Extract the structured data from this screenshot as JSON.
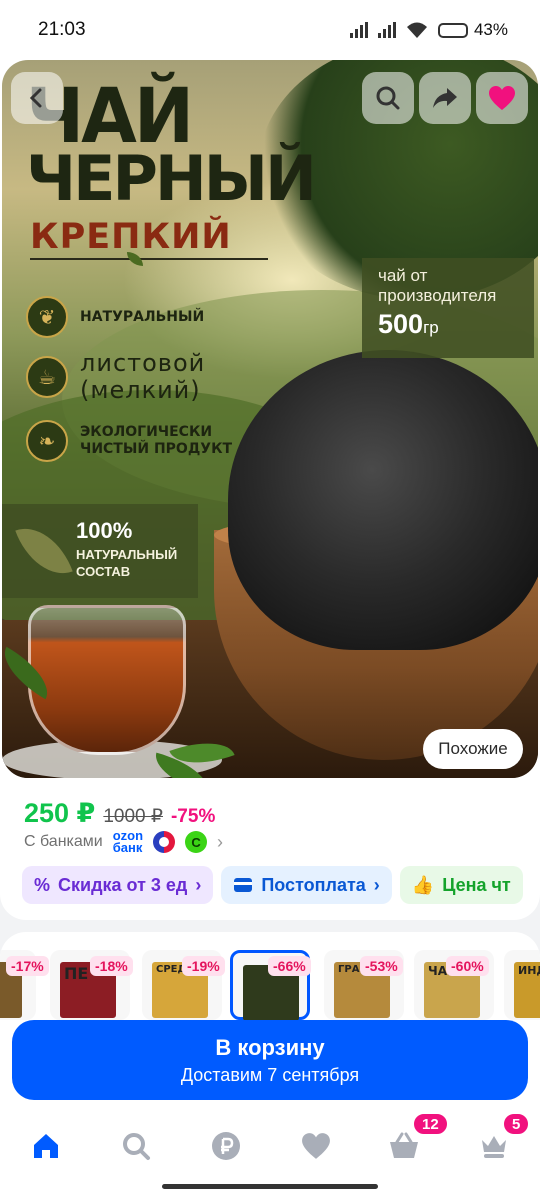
{
  "status_bar": {
    "time": "21:03",
    "battery": "43%"
  },
  "gallery": {
    "headline_line1": "ЧАЙ",
    "headline_line2": "ЧЕРНЫЙ",
    "headline_sub": "КРЕПКИЙ",
    "features": [
      {
        "icon": "leaf-icon",
        "text": "НАТУРАЛЬНЫЙ"
      },
      {
        "icon": "teacup-icon",
        "text_line1": "листовой",
        "text_line2": "(мелкий)"
      },
      {
        "icon": "eco-leaf-icon",
        "text_line1": "ЭКОЛОГИЧЕСКИ",
        "text_line2": "ЧИСТЫЙ ПРОДУКТ"
      }
    ],
    "producer_line1": "чай от",
    "producer_line2": "производителя",
    "weight_value": "500",
    "weight_unit": "гр",
    "natural_percent": "100%",
    "natural_line1": "НАТУРАЛЬНЫЙ",
    "natural_line2": "СОСТАВ",
    "similar_label": "Похожие"
  },
  "price": {
    "current": "250 ₽",
    "old": "1000 ₽",
    "discount": "-75%",
    "banks_label": "С банками",
    "ozon_line1": "ozon",
    "ozon_line2": "банк",
    "green_logo_glyph": "С"
  },
  "tags": [
    {
      "label": "Скидка от 3 ед",
      "icon": "percent-icon",
      "color": "#6a2cd4"
    },
    {
      "label": "Постоплата",
      "icon": "card-icon",
      "color": "#0a58d4"
    },
    {
      "label": "Цена чт",
      "icon": "thumb-up-icon",
      "color": "#14a32b"
    }
  ],
  "variants": [
    {
      "discount": "-17%",
      "label": "",
      "pack_color": "#7a5a2a"
    },
    {
      "discount": "-18%",
      "label": "ПЕ",
      "pack_color": "#8c1d24"
    },
    {
      "discount": "-19%",
      "label": "СРЕДНЕ",
      "pack_color": "#d6a63a"
    },
    {
      "discount": "-66%",
      "label": "",
      "pack_color": "#2f3a1c"
    },
    {
      "discount": "-53%",
      "label": "ГРАНУЛ",
      "pack_color": "#b58a3c"
    },
    {
      "discount": "-60%",
      "label": "ЧАЙ",
      "pack_color": "#c9a54c"
    },
    {
      "discount": "",
      "label": "ИНДИ",
      "pack_color": "#c99a2a"
    }
  ],
  "cart": {
    "title": "В корзину",
    "subtitle": "Доставим 7 сентября"
  },
  "bottom_nav": {
    "cart_badge": "12",
    "profile_badge": "5"
  },
  "colors": {
    "brand_blue": "#005bff",
    "price_green": "#10c44c",
    "discount_pink": "#f1117e"
  }
}
